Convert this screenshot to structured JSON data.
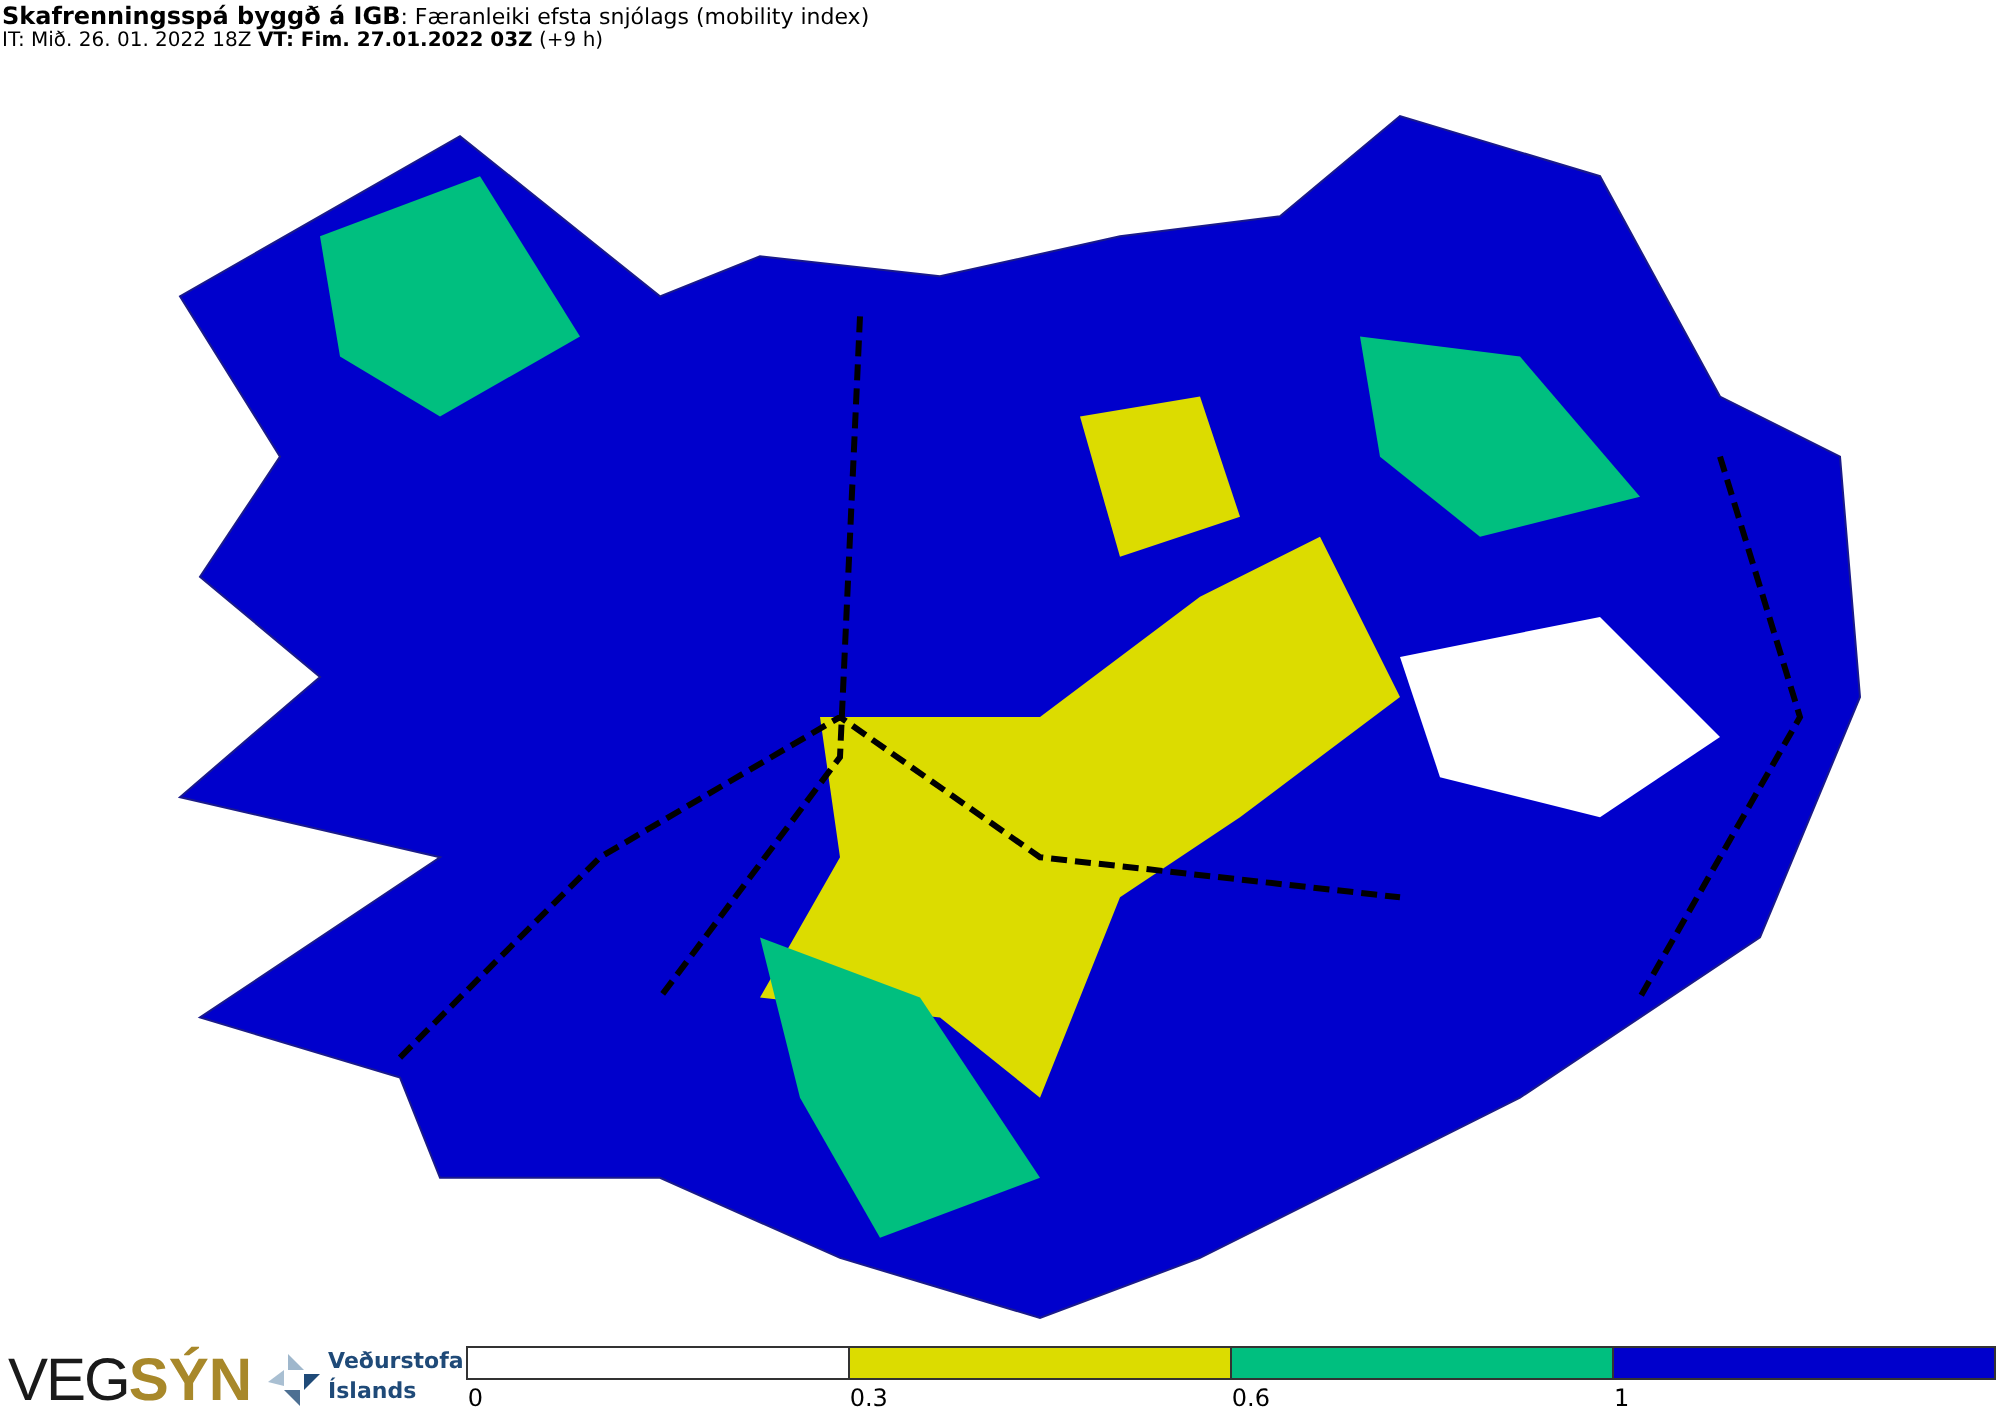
{
  "header": {
    "title": "**Skafrenningsspá byggð á IGB**: Færanleiki efsta snjólags (mobility index)",
    "subtitle": "IT: Mið. 26. 01. 2022 18Z **VT: Fim. 27.01.2022 03Z** (+9 h)"
  },
  "logos": {
    "vegsyn": [
      "VEG",
      "SÝN"
    ],
    "agency": [
      "Veðurstofa",
      "Íslands"
    ]
  },
  "legend": [
    {
      "label": "0",
      "color": "#ffffff"
    },
    {
      "label": "0.3",
      "color": "#dcdc00"
    },
    {
      "label": "0.6",
      "color": "#00bf7f"
    },
    {
      "label": "1",
      "color": "#0000cc"
    }
  ]
}
